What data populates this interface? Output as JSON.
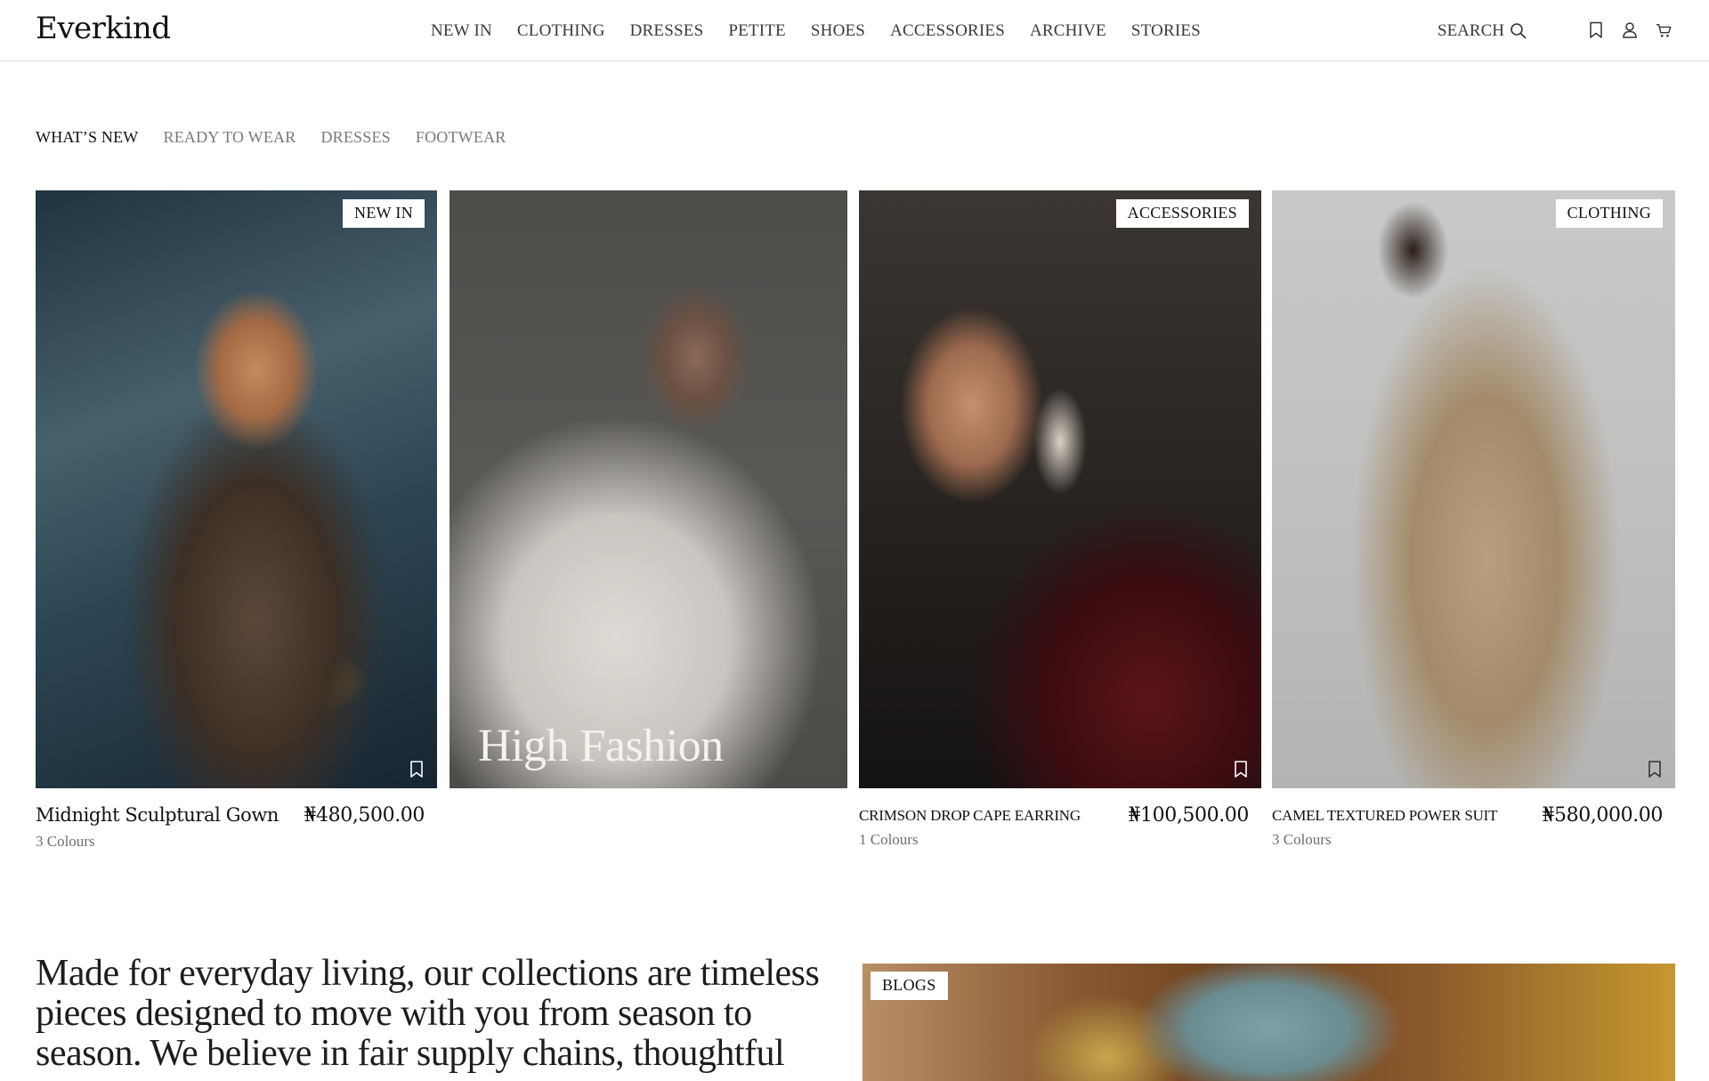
{
  "header": {
    "logo": "Everkind",
    "nav": [
      "NEW IN",
      "CLOTHING",
      "DRESSES",
      "PETITE",
      "SHOES",
      "ACCESSORIES",
      "ARCHIVE",
      "STORIES"
    ],
    "search_label": "SEARCH",
    "icons": [
      "search-icon",
      "bookmark-icon",
      "user-icon",
      "cart-icon"
    ]
  },
  "tabs": [
    "WHAT’S NEW",
    "READY TO WEAR",
    "DRESSES",
    "FOOTWEAR"
  ],
  "products": [
    {
      "badge": "NEW IN",
      "name": "Midnight Sculptural Gown",
      "price": "₦480,500.00",
      "colours": "3 Colours"
    },
    {
      "overlay_title": "High Fashion"
    },
    {
      "badge": "ACCESSORIES",
      "name": "CRIMSON DROP  CAPE EARRING",
      "price": "₦100,500.00",
      "colours": "1 Colours"
    },
    {
      "badge": "CLOTHING",
      "name": "CAMEL TEXTURED POWER SUIT",
      "price": "₦580,000.00",
      "colours": "3 Colours"
    }
  ],
  "about_text": "Made for everyday living, our collections are timeless pieces designed to move with you from season to season. We believe in fair supply chains, thoughtful",
  "blog": {
    "badge": "BLOGS"
  }
}
